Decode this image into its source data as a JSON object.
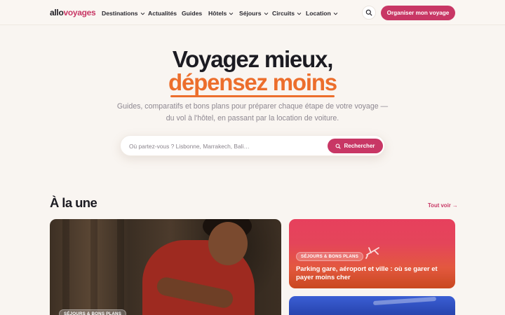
{
  "header": {
    "logo_part1": "allo",
    "logo_part2": "voyages",
    "nav": [
      {
        "label": "Destinations",
        "has_dropdown": true
      },
      {
        "label": "Actualités",
        "has_dropdown": false
      },
      {
        "label": "Guides",
        "has_dropdown": false
      },
      {
        "label": "Hôtels",
        "has_dropdown": true
      },
      {
        "label": "Séjours",
        "has_dropdown": true
      },
      {
        "label": "Circuits",
        "has_dropdown": true
      },
      {
        "label": "Location",
        "has_dropdown": true
      }
    ],
    "search_icon": "search-icon",
    "cta_label": "Organiser mon voyage"
  },
  "hero": {
    "title_line1": "Voyagez mieux,",
    "title_line2": "dépensez moins",
    "subtitle": "Guides, comparatifs et bons plans pour préparer chaque étape de votre voyage — du vol à l'hôtel, en passant par la location de voiture.",
    "search_placeholder": "Où partez-vous ? Lisbonne, Marrakech, Bali…",
    "search_button": "Rechercher"
  },
  "featured": {
    "title": "À la une",
    "see_all": "Tout voir →",
    "cards": [
      {
        "badge": "SÉJOURS & BONS PLANS",
        "title": ""
      },
      {
        "badge": "SÉJOURS & BONS PLANS",
        "title": "Parking gare, aéroport et ville : où se garer et payer moins cher"
      },
      {
        "badge": "",
        "title": ""
      }
    ]
  },
  "colors": {
    "brand": "#c83765",
    "accent_orange": "#ec6e2c",
    "background": "#f9f5f1",
    "text": "#1c1b22"
  }
}
